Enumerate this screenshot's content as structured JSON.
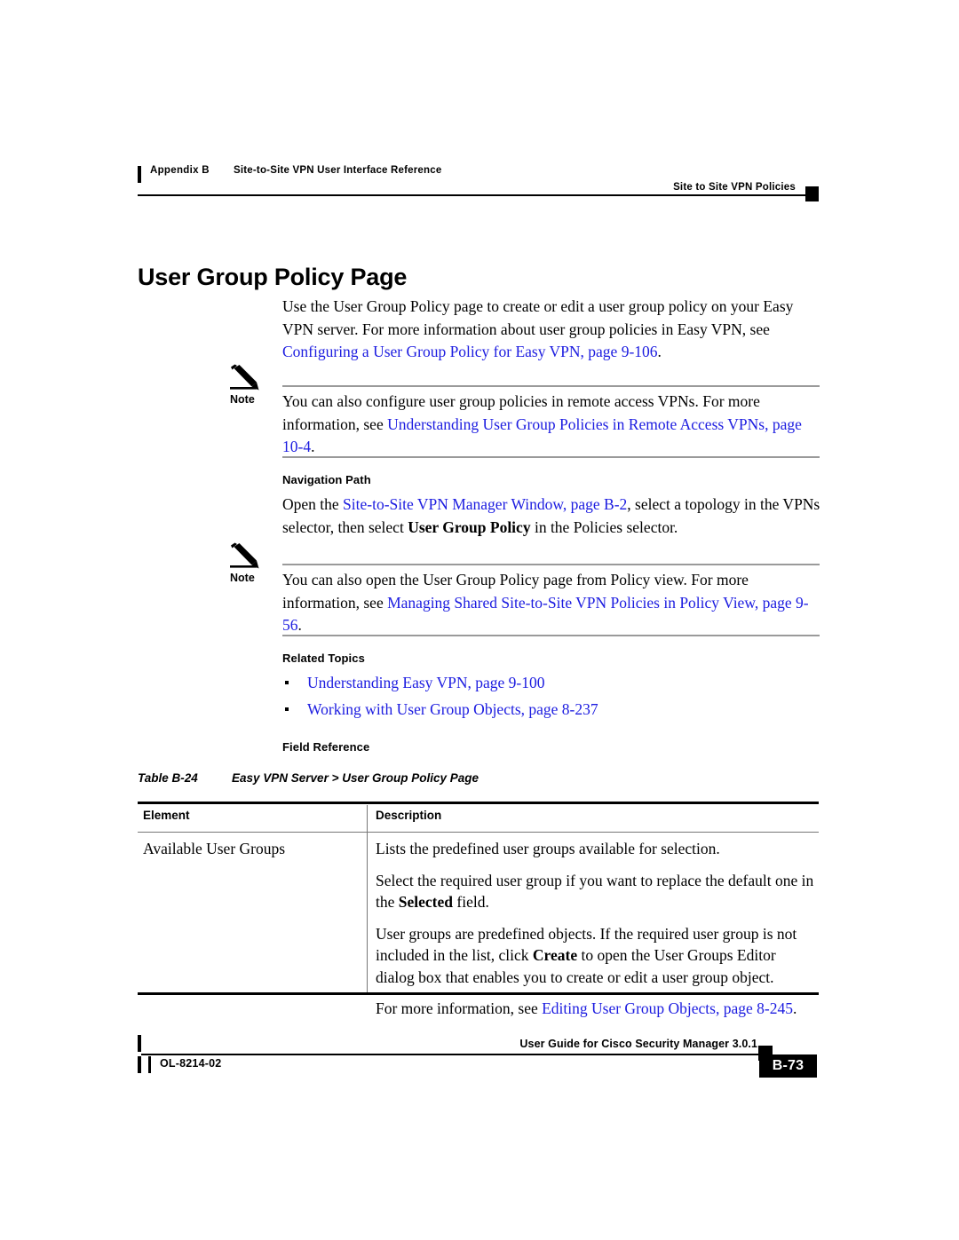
{
  "header": {
    "appendix": "Appendix B",
    "chapter_title": "Site-to-Site VPN User Interface Reference",
    "section_title": "Site to Site VPN Policies"
  },
  "page_title": "User Group Policy Page",
  "intro": {
    "text_1": "Use the User Group Policy page to create or edit a user group policy on your Easy VPN server. For more information about user group policies in Easy VPN, see ",
    "link_1": "Configuring a User Group Policy for Easy VPN, page 9-106",
    "text_2": "."
  },
  "note_1": {
    "label": "Note",
    "icon": "pencil-icon",
    "text_1": "You can also configure user group policies in remote access VPNs. For more information, see ",
    "link_1": "Understanding User Group Policies in Remote Access VPNs, page 10-4",
    "text_2": "."
  },
  "navigation_path": {
    "heading": "Navigation Path",
    "text_1": "Open the ",
    "link_1": "Site-to-Site VPN Manager Window, page B-2",
    "text_2": ", select a topology in the VPNs selector, then select ",
    "bold_1": "User Group Policy",
    "text_3": " in the Policies selector."
  },
  "note_2": {
    "label": "Note",
    "icon": "pencil-icon",
    "text_1": "You can also open the User Group Policy page from Policy view. For more information, see ",
    "link_1": "Managing Shared Site-to-Site VPN Policies in Policy View, page 9-56",
    "text_2": "."
  },
  "related_topics": {
    "heading": "Related Topics",
    "items": [
      "Understanding Easy VPN, page 9-100",
      "Working with User Group Objects, page 8-237"
    ]
  },
  "field_reference": {
    "heading": "Field Reference"
  },
  "table": {
    "caption_number": "Table B-24",
    "caption_title": "Easy VPN Server > User Group Policy Page",
    "columns": [
      "Element",
      "Description"
    ],
    "rows": [
      {
        "element": "Available User Groups",
        "description_paragraphs": [
          {
            "parts": [
              {
                "type": "text",
                "value": "Lists the predefined user groups available for selection."
              }
            ]
          },
          {
            "parts": [
              {
                "type": "text",
                "value": "Select the required user group if you want to replace the default one in the "
              },
              {
                "type": "bold",
                "value": "Selected"
              },
              {
                "type": "text",
                "value": " field."
              }
            ]
          },
          {
            "parts": [
              {
                "type": "text",
                "value": "User groups are predefined objects. If the required user group is not included in the list, click "
              },
              {
                "type": "bold",
                "value": "Create"
              },
              {
                "type": "text",
                "value": " to open the User Groups Editor dialog box that enables you to create or edit a user group object."
              }
            ]
          },
          {
            "parts": [
              {
                "type": "text",
                "value": "For more information, see "
              },
              {
                "type": "link",
                "value": "Editing User Group Objects, page 8-245"
              },
              {
                "type": "text",
                "value": "."
              }
            ]
          }
        ]
      }
    ]
  },
  "footer": {
    "guide_title": "User Guide for Cisco Security Manager 3.0.1",
    "doc_id": "OL-8214-02",
    "page_number": "B-73"
  },
  "colors": {
    "link": "#1c1ce0",
    "text": "#000000",
    "rule_gray": "#9a9a9a",
    "background": "#ffffff"
  }
}
